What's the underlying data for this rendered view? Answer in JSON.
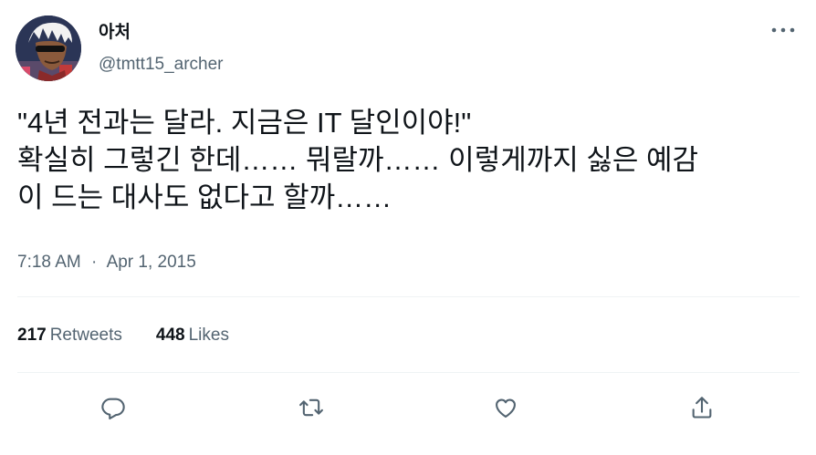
{
  "author": {
    "name": "아처",
    "handle": "@tmtt15_archer"
  },
  "tweet": {
    "lines": [
      "\"4년 전과는 달라. 지금은 IT 달인이야!\"",
      "확실히 그렇긴 한데…… 뭐랄까…… 이렇게까지 싫은 예감",
      "이 드는 대사도 없다고 할까……"
    ],
    "time": "7:18 AM",
    "separator": "·",
    "date": "Apr 1, 2015"
  },
  "stats": {
    "retweets_count": "217",
    "retweets_label": "Retweets",
    "likes_count": "448",
    "likes_label": "Likes"
  },
  "icons": {
    "more": "more-icon",
    "reply": "reply-icon",
    "retweet": "retweet-icon",
    "like": "like-icon",
    "share": "share-icon"
  },
  "colors": {
    "text": "#0f1419",
    "secondary": "#536471",
    "divider": "#eff3f4"
  }
}
